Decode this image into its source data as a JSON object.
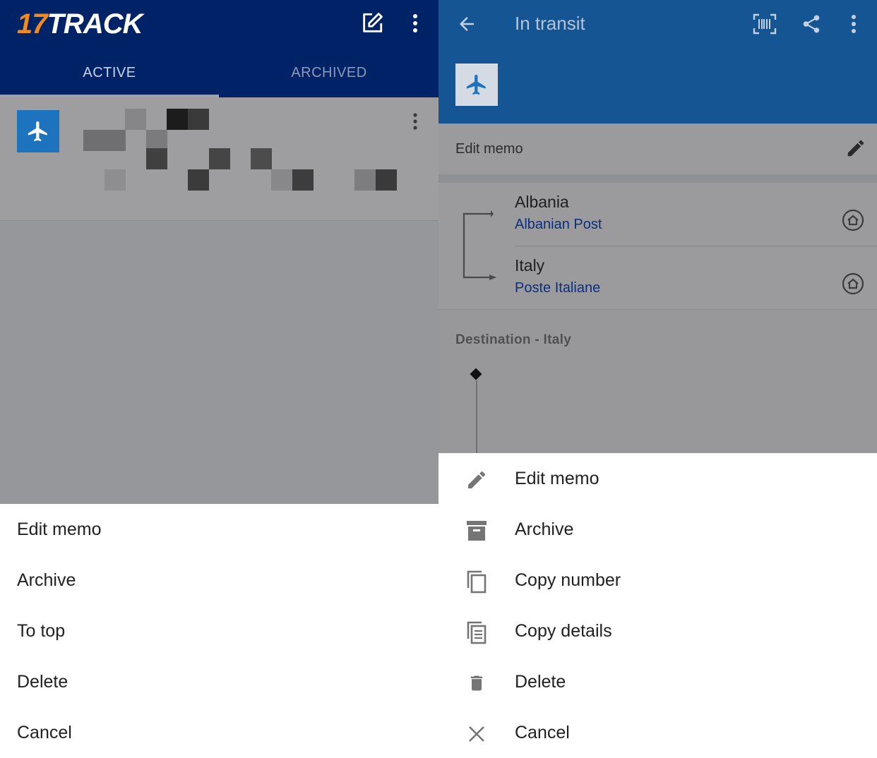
{
  "left": {
    "logo": {
      "number": "17",
      "word": "TRACK"
    },
    "toolbar": {
      "edit_icon": "edit-note-icon",
      "more_icon": "more-vert-icon"
    },
    "tabs": [
      {
        "label": "ACTIVE",
        "selected": true
      },
      {
        "label": "ARCHIVED",
        "selected": false
      }
    ],
    "item": {
      "type_icon": "airplane-icon",
      "tracking_number": "",
      "redacted": true
    },
    "sheet": {
      "items": [
        {
          "label": "Edit memo"
        },
        {
          "label": "Archive"
        },
        {
          "label": "To top"
        },
        {
          "label": "Delete"
        },
        {
          "label": "Cancel"
        }
      ]
    }
  },
  "right": {
    "toolbar": {
      "title": "In transit",
      "back_icon": "arrow-back-icon",
      "actions": [
        "barcode-scan-icon",
        "share-icon",
        "more-vert-icon"
      ]
    },
    "package_icon": "airplane-icon",
    "memo": {
      "label": "Edit memo",
      "icon": "pencil-icon"
    },
    "route": {
      "origin": {
        "country": "Albania",
        "carrier": "Albanian Post"
      },
      "destination": {
        "country": "Italy",
        "carrier": "Poste Italiane"
      }
    },
    "destination_header": "Destination - Italy",
    "sheet": {
      "items": [
        {
          "label": "Edit memo",
          "icon": "pencil-icon"
        },
        {
          "label": "Archive",
          "icon": "archive-box-icon"
        },
        {
          "label": "Copy number",
          "icon": "copy-icon"
        },
        {
          "label": "Copy details",
          "icon": "copy-details-icon"
        },
        {
          "label": "Delete",
          "icon": "trash-icon"
        },
        {
          "label": "Cancel",
          "icon": "close-icon"
        }
      ]
    }
  },
  "colors": {
    "left_appbar": "#002267",
    "right_appbar": "#155594",
    "logo_accent": "#f28a1c",
    "plane_tile": "#1e73be",
    "carrier_link": "#0b2f7d",
    "scrim": "#96979b"
  }
}
